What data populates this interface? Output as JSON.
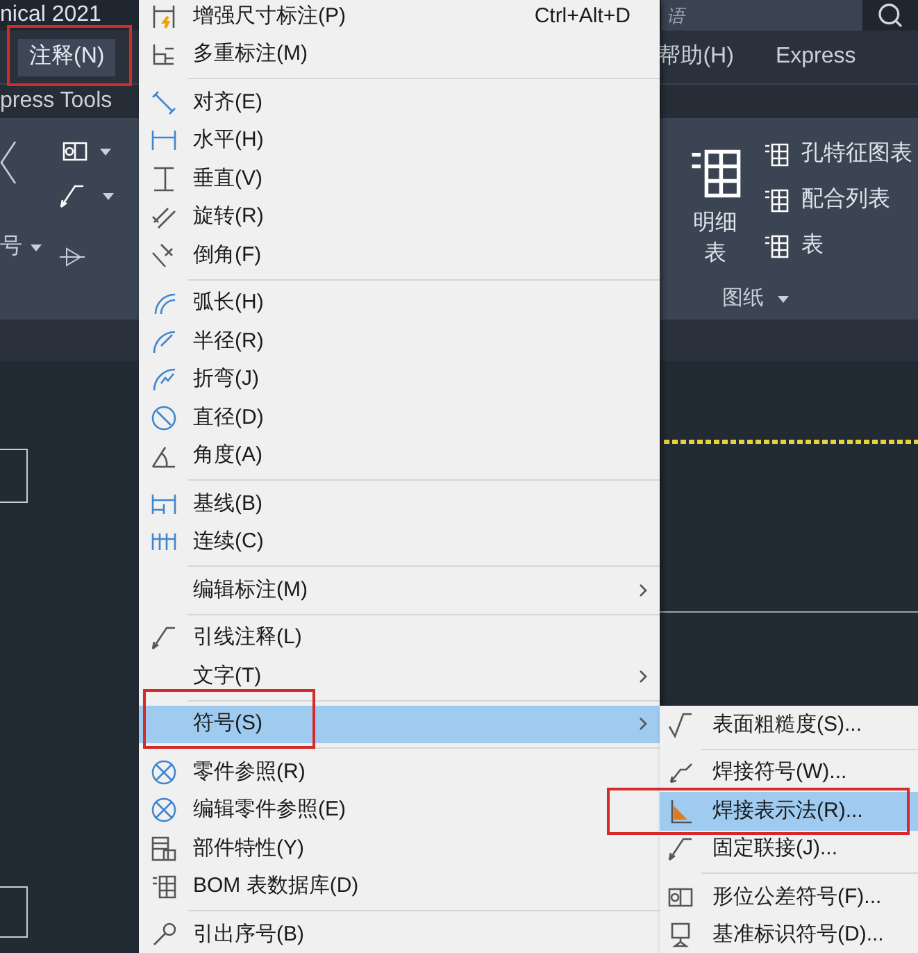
{
  "title_bar": {
    "title": "nical 2021",
    "search": {
      "placeholder": "语"
    }
  },
  "menu_bar": {
    "left": [
      {
        "label": "注释(N)",
        "selected": true,
        "callout": true
      }
    ],
    "right": [
      {
        "label": "帮助(H)",
        "selected": false
      },
      {
        "label": "Express",
        "selected": false
      }
    ]
  },
  "ribbon_tab": "press Tools",
  "ribbon": {
    "dropdown_label": "号",
    "large_button": "明细表",
    "items": [
      "孔特征图表",
      "配合列表",
      "表"
    ],
    "panel_label": "图纸"
  },
  "menu": {
    "groups": [
      [
        {
          "label": "增强尺寸标注(P)",
          "shortcut": "Ctrl+Alt+D",
          "submenu": false,
          "selected": false,
          "callout": false
        },
        {
          "label": "多重标注(M)",
          "submenu": false,
          "selected": false,
          "callout": false
        }
      ],
      [
        {
          "label": "对齐(E)",
          "submenu": false,
          "selected": false,
          "callout": false
        },
        {
          "label": "水平(H)",
          "submenu": false,
          "selected": false,
          "callout": false
        },
        {
          "label": "垂直(V)",
          "submenu": false,
          "selected": false,
          "callout": false
        },
        {
          "label": "旋转(R)",
          "submenu": false,
          "selected": false,
          "callout": false
        },
        {
          "label": "倒角(F)",
          "submenu": false,
          "selected": false,
          "callout": false
        }
      ],
      [
        {
          "label": "弧长(H)",
          "submenu": false,
          "selected": false,
          "callout": false
        },
        {
          "label": "半径(R)",
          "submenu": false,
          "selected": false,
          "callout": false
        },
        {
          "label": "折弯(J)",
          "submenu": false,
          "selected": false,
          "callout": false
        },
        {
          "label": "直径(D)",
          "submenu": false,
          "selected": false,
          "callout": false
        },
        {
          "label": "角度(A)",
          "submenu": false,
          "selected": false,
          "callout": false
        }
      ],
      [
        {
          "label": "基线(B)",
          "submenu": false,
          "selected": false,
          "callout": false
        },
        {
          "label": "连续(C)",
          "submenu": false,
          "selected": false,
          "callout": false
        }
      ],
      [
        {
          "label": "编辑标注(M)",
          "submenu": true,
          "selected": false,
          "callout": false
        }
      ],
      [
        {
          "label": "引线注释(L)",
          "submenu": false,
          "selected": false,
          "callout": false
        },
        {
          "label": "文字(T)",
          "submenu": true,
          "selected": false,
          "callout": false
        }
      ],
      [
        {
          "label": "符号(S)",
          "submenu": true,
          "selected": true,
          "callout": true
        }
      ],
      [
        {
          "label": "零件参照(R)",
          "submenu": false,
          "selected": false,
          "callout": false
        },
        {
          "label": "编辑零件参照(E)",
          "submenu": false,
          "selected": false,
          "callout": false
        },
        {
          "label": "部件特性(Y)",
          "submenu": false,
          "selected": false,
          "callout": false
        },
        {
          "label": "BOM 表数据库(D)",
          "submenu": false,
          "selected": false,
          "callout": false
        }
      ],
      [
        {
          "label": "引出序号(B)",
          "submenu": false,
          "selected": false,
          "callout": false
        }
      ]
    ]
  },
  "submenu": {
    "groups": [
      [
        {
          "label": "表面粗糙度(S)...",
          "selected": false,
          "callout": false
        }
      ],
      [
        {
          "label": "焊接符号(W)...",
          "selected": false,
          "callout": false
        },
        {
          "label": "焊接表示法(R)...",
          "selected": true,
          "callout": true
        },
        {
          "label": "固定联接(J)...",
          "selected": false,
          "callout": false
        }
      ],
      [
        {
          "label": "形位公差符号(F)...",
          "selected": false,
          "callout": false
        },
        {
          "label": "基准标识符号(D)...",
          "selected": false,
          "callout": false
        }
      ]
    ]
  }
}
